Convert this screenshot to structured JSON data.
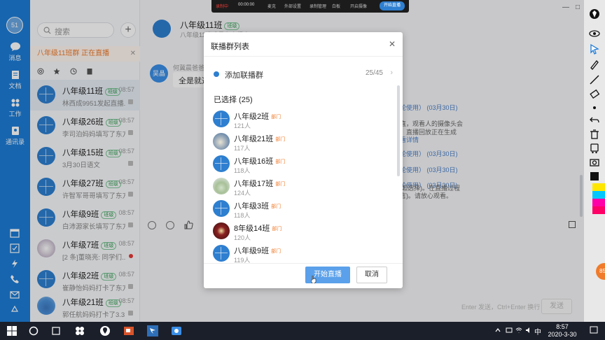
{
  "nav": {
    "avatar_text": "51",
    "items": [
      {
        "label": "消息",
        "icon": "message-icon"
      },
      {
        "label": "文档",
        "icon": "document-icon"
      },
      {
        "label": "工作",
        "icon": "apps-grid-icon"
      },
      {
        "label": "通讯录",
        "icon": "contacts-icon"
      }
    ],
    "accent_color": "#1d7cd6"
  },
  "conversation_list": {
    "search_placeholder": "搜索",
    "live_banner": "八年级11班群 正在直播",
    "items": [
      {
        "name": "八年级11班",
        "badge": "班级",
        "time": "08:57",
        "preview": "林西成9951发起直播...",
        "avatar": "group",
        "muted": true,
        "active": true
      },
      {
        "name": "八年级26班",
        "badge": "班级",
        "time": "08:57",
        "preview": "李司泊妈妈填写了东方...",
        "avatar": "group",
        "muted": true
      },
      {
        "name": "八年级15班",
        "badge": "班级",
        "time": "08:57",
        "preview": "3月30日语文",
        "avatar": "group",
        "muted": true
      },
      {
        "name": "八年级27班",
        "badge": "班级",
        "time": "08:57",
        "preview": "许智军哥哥填写了东方...",
        "avatar": "group",
        "muted": true
      },
      {
        "name": "八年级9班",
        "badge": "班级",
        "time": "08:57",
        "preview": "白沛源家长填写了东方...",
        "avatar": "group",
        "muted": true
      },
      {
        "name": "八年级7班",
        "badge": "班级",
        "time": "08:57",
        "preview": "[2 条]董晓亮: 同学们...",
        "avatar": "photo2",
        "muted": true,
        "unread": true
      },
      {
        "name": "八年级2班",
        "badge": "班级",
        "time": "08:57",
        "preview": "崔静怡妈妈打卡了东方...",
        "avatar": "group",
        "muted": true
      },
      {
        "name": "八年级21班",
        "badge": "班级",
        "time": "08:57",
        "preview": "郭任航妈妈打卡了3.3...",
        "avatar": "photo3",
        "muted": true
      }
    ]
  },
  "chat": {
    "title": "八年级11班",
    "title_badge": "班级",
    "subtitle": "八年级11班成员在直播中",
    "sender_avatar": "吴晶",
    "sender_name": "何冀晨爸爸",
    "bubble_text": "全是就选",
    "right_lines": [
      {
        "text": "轮使用） (03月30日)",
        "color": "blue"
      },
      {
        "text": "直，观看人的摄像头会",
        "color": "gray"
      },
      {
        "text": "，直播回放正在生成",
        "color": "gray"
      },
      {
        "text": "看详情",
        "color": "blue"
      },
      {
        "text": "轮使用） (03月30日)",
        "color": "blue"
      },
      {
        "text": "轮使用） (03月30日)",
        "color": "blue"
      },
      {
        "text": "轮使用） (03月30日)",
        "color": "blue"
      },
      {
        "text": "如选择)。在直播过程",
        "color": "gray"
      },
      {
        "text": "言)。请放心观看。",
        "color": "gray"
      }
    ],
    "input_hint": "Enter 发送，Ctrl+Enter 换行",
    "send_label": "发送"
  },
  "modal": {
    "title": "联播群列表",
    "add_label": "添加联播群",
    "add_count": "25/45",
    "selected_title": "已选择 (25)",
    "groups": [
      {
        "name": "八年级2班",
        "tag": "部门",
        "count": "121人",
        "avatar": "group"
      },
      {
        "name": "八年级21班",
        "tag": "部门",
        "count": "117人",
        "avatar": "photo1"
      },
      {
        "name": "八年级16班",
        "tag": "部门",
        "count": "118人",
        "avatar": "group"
      },
      {
        "name": "八年级17班",
        "tag": "部门",
        "count": "124人",
        "avatar": "photo2"
      },
      {
        "name": "八年级3班",
        "tag": "部门",
        "count": "118人",
        "avatar": "group"
      },
      {
        "name": "8年级14班",
        "tag": "部门",
        "count": "120人",
        "avatar": "photo3"
      },
      {
        "name": "八年级9班",
        "tag": "部门",
        "count": "119人",
        "avatar": "group"
      }
    ],
    "start_label": "开始直播",
    "cancel_label": "取消"
  },
  "recording_bar": {
    "status": "录制中",
    "timer": "00:00:00",
    "options": [
      "麦克",
      "外部设置",
      "录制管理",
      "白板",
      "开启摄像"
    ],
    "go_label": "开始直播"
  },
  "taskbar": {
    "ime": "中",
    "time": "8:57",
    "date": "2020-3-30"
  },
  "live_float": "85"
}
